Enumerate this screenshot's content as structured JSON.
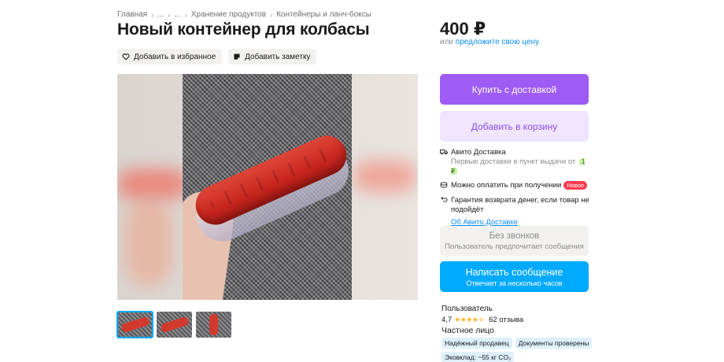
{
  "breadcrumb": [
    "Главная",
    "...",
    "...",
    "Хранение продуктов",
    "Контейнеры и ланч-боксы"
  ],
  "title": "Новый контейнер для колбасы",
  "actions": {
    "favorite_label": "Добавить в избранное",
    "note_label": "Добавить заметку"
  },
  "icons": {
    "favorite": "heart-icon",
    "note": "note-icon",
    "delivery": "truck-icon",
    "payment": "coins-icon",
    "guarantee": "return-arrow-icon"
  },
  "gallery": {
    "active_index": 0,
    "thumbnail_count": 3
  },
  "price": {
    "value": "400 ₽",
    "sub_prefix": "или",
    "sub_link": "предложите свою цену"
  },
  "buttons": {
    "buy": "Купить с доставкой",
    "cart": "Добавить в корзину",
    "no_calls_title": "Без звонков",
    "no_calls_sub": "Пользователь предпочитает сообщения",
    "message_title": "Написать сообщение",
    "message_sub": "Отвечает за несколько часов"
  },
  "delivery": {
    "title": "Авито Доставка",
    "sub": "Первые доставки в пункт выдачи от",
    "sub_price": "1 ₽",
    "payment": "Можно оплатить при получении",
    "payment_badge": "Новое",
    "guarantee": "Гарантия возврата денег, если товар не подойдёт",
    "link": "Об Авито Доставке"
  },
  "seller": {
    "name": "Пользователь",
    "rating": "4,7",
    "rating_value": 4.7,
    "reviews": "62 отзыва",
    "type": "Частное лицо",
    "badges": [
      "Надёжный продавец",
      "Документы проверены",
      "Эковклад: ~55 кг CO₂"
    ]
  },
  "colors": {
    "accent_purple": "#9e5cf5",
    "cart_bg": "#efe5fe",
    "message_blue": "#00aaff",
    "link_blue": "#0a8cff",
    "star": "#ffb021",
    "badge_new": "#ff3d4f"
  }
}
